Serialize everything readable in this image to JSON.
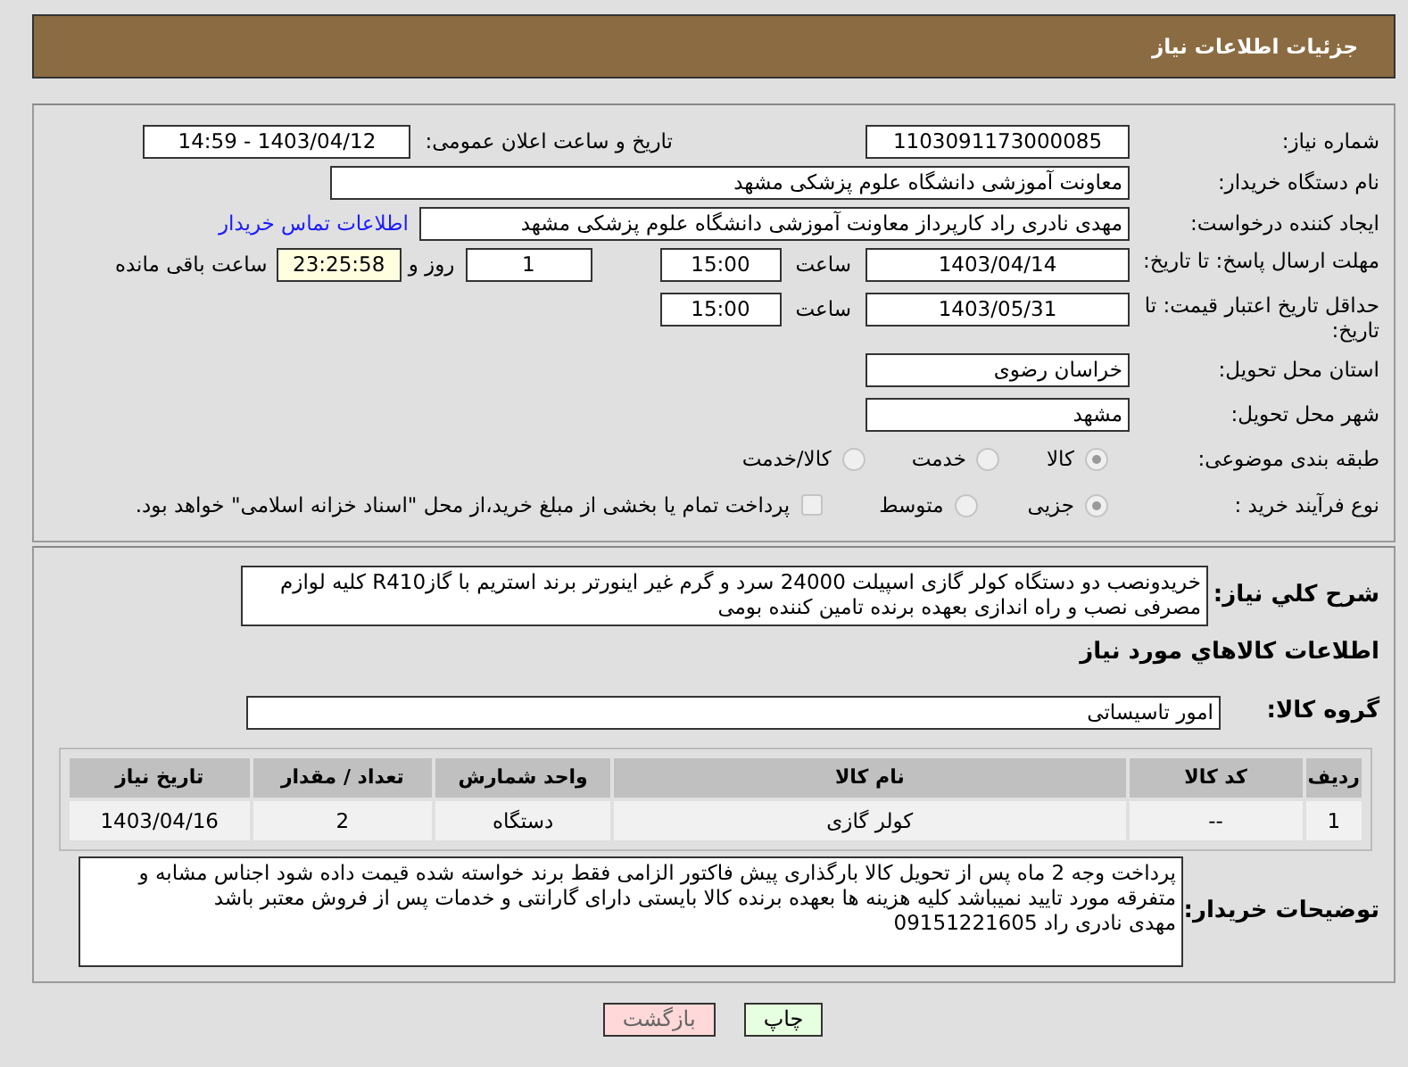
{
  "header": {
    "title": "جزئیات اطلاعات نیاز"
  },
  "need_number": {
    "label": "شماره نیاز:",
    "value": "1103091173000085"
  },
  "announce": {
    "label": "تاریخ و ساعت اعلان عمومی:",
    "value": "1403/04/12 - 14:59"
  },
  "buyer_org": {
    "label": "نام دستگاه خریدار:",
    "value": "معاونت آموزشی دانشگاه علوم پزشکی مشهد"
  },
  "requester": {
    "label": "ایجاد کننده درخواست:",
    "value": "مهدی نادری راد کارپرداز معاونت آموزشی دانشگاه علوم پزشکی مشهد",
    "link": "اطلاعات تماس خریدار"
  },
  "reply_deadline": {
    "label": "مهلت ارسال پاسخ: تا تاریخ:",
    "date": "1403/04/14",
    "time_label": "ساعت",
    "time": "15:00",
    "days": "1",
    "days_label": "روز و",
    "remaining": "23:25:58",
    "remaining_label": "ساعت باقی مانده"
  },
  "price_validity": {
    "label": "حداقل تاریخ اعتبار قیمت: تا تاریخ:",
    "date": "1403/05/31",
    "time_label": "ساعت",
    "time": "15:00"
  },
  "province": {
    "label": "استان محل تحویل:",
    "value": "خراسان رضوی"
  },
  "city": {
    "label": "شهر محل تحویل:",
    "value": "مشهد"
  },
  "category": {
    "label": "طبقه بندی موضوعی:",
    "options": [
      {
        "label": "کالا",
        "selected": true
      },
      {
        "label": "خدمت",
        "selected": false
      },
      {
        "label": "کالا/خدمت",
        "selected": false
      }
    ]
  },
  "purchase_type": {
    "label": "نوع فرآیند خرید :",
    "options": [
      {
        "label": "جزیی",
        "selected": true
      },
      {
        "label": "متوسط",
        "selected": false
      }
    ],
    "payment": {
      "label": "پرداخت تمام یا بخشی از مبلغ خرید،از محل \"اسناد خزانه اسلامی\" خواهد بود.",
      "checked": false
    }
  },
  "description": {
    "label": "شرح کلي نياز:",
    "value": "خریدونصب دو دستگاه کولر گازی اسپیلت 24000 سرد و گرم غیر اینورتر برند استریم با گازR410 کلیه لوازم مصرفی نصب و راه اندازی بعهده برنده تامین کننده بومی"
  },
  "goods_section": {
    "title": "اطلاعات کالاهاي مورد نياز"
  },
  "goods_group": {
    "label": "گروه کالا:",
    "value": "امور تاسیساتی"
  },
  "table": {
    "columns": [
      "ردیف",
      "کد کالا",
      "نام کالا",
      "واحد شمارش",
      "تعداد / مقدار",
      "تاریخ نیاز"
    ],
    "rows": [
      [
        "1",
        "--",
        "کولر گازی",
        "دستگاه",
        "2",
        "1403/04/16"
      ]
    ]
  },
  "buyer_notes": {
    "label": "توضیحات خریدار:",
    "value": "پرداخت وجه 2 ماه پس از تحویل کالا بارگذاری پیش فاکتور الزامی فقط برند خواسته شده قیمت داده شود اجناس مشابه و متفرقه مورد تایید نمیباشد کلیه هزینه ها بعهده برنده کالا بایستی دارای گارانتی و خدمات پس از فروش معتبر باشد\nمهدی نادری راد 09151221605"
  },
  "buttons": [
    {
      "label": "چاپ",
      "kind": "print"
    },
    {
      "label": "بازگشت",
      "kind": "back"
    }
  ]
}
